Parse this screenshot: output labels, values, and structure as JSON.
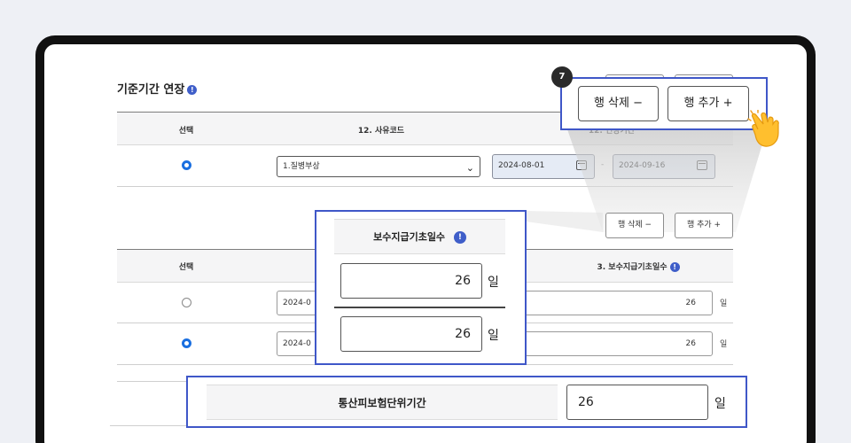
{
  "section1": {
    "title": "기준기간 연장",
    "headers": {
      "select": "선택",
      "reason_code": "12. 사유코드",
      "period": "12. 연장기간"
    },
    "row": {
      "reason_value": "1.질병부상",
      "date_from": "2024-08-01",
      "date_sep": "-",
      "date_to": "2024-09-16"
    }
  },
  "section2": {
    "delete_label": "행 삭제 −",
    "add_label": "행 추가 +",
    "headers": {
      "select": "선택",
      "days": "3. 보수지급기초일수"
    },
    "rows": [
      {
        "date": "2024-0",
        "days": "26",
        "unit": "일"
      },
      {
        "date": "2024-0",
        "days": "26",
        "unit": "일"
      }
    ]
  },
  "callout_buttons": {
    "step": "7",
    "delete_label": "행 삭제 −",
    "add_label": "행 추가 +"
  },
  "callout_days": {
    "header": "보수지급기초일수",
    "rows": [
      {
        "value": "26",
        "unit": "일"
      },
      {
        "value": "26",
        "unit": "일"
      }
    ]
  },
  "callout_total": {
    "label": "통산피보험단위기간",
    "value": "26",
    "unit": "일"
  },
  "icons": {
    "info": "info-icon",
    "calendar": "calendar-icon",
    "chevron": "chevron-down-icon",
    "pointer": "hand-pointer-icon"
  },
  "colors": {
    "accent": "#3f57c8",
    "radio_on": "#1a6fe0"
  }
}
